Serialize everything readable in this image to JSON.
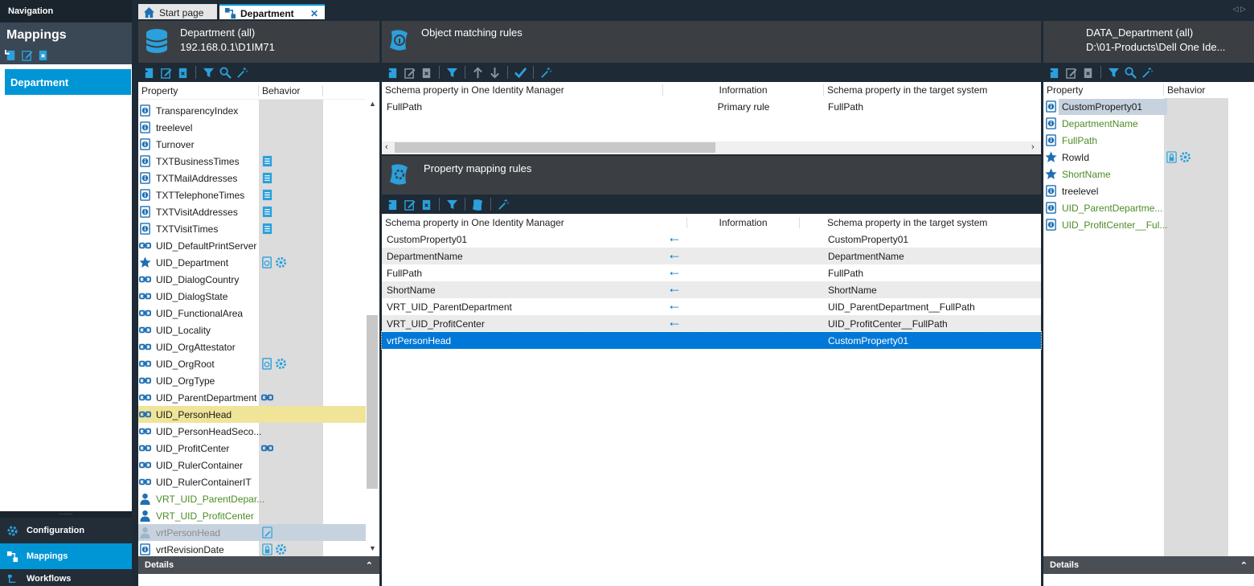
{
  "navigation": {
    "title": "Navigation",
    "section_title": "Mappings",
    "selected_item": "Department",
    "bottom": [
      {
        "label": "Configuration",
        "icon": "gear-icon"
      },
      {
        "label": "Mappings",
        "icon": "mappings-icon"
      },
      {
        "label": "Workflows",
        "icon": "workflow-icon"
      }
    ]
  },
  "tabs": [
    {
      "label": "Start page",
      "icon": "home-icon"
    },
    {
      "label": "Department",
      "icon": "mapping-icon",
      "active": true
    }
  ],
  "left_pane": {
    "title": "Department (all)",
    "subtitle": "192.168.0.1\\D1IM71",
    "col_property": "Property",
    "col_behavior": "Behavior",
    "rows": [
      {
        "label": "TransparencyIndex",
        "icon": "info",
        "style": "normal"
      },
      {
        "label": "treelevel",
        "icon": "info",
        "style": "normal"
      },
      {
        "label": "Turnover",
        "icon": "info",
        "style": "normal"
      },
      {
        "label": "TXTBusinessTimes",
        "icon": "info",
        "style": "normal",
        "behavior": [
          "list"
        ]
      },
      {
        "label": "TXTMailAddresses",
        "icon": "info",
        "style": "normal",
        "behavior": [
          "list"
        ]
      },
      {
        "label": "TXTTelephoneTimes",
        "icon": "info",
        "style": "normal",
        "behavior": [
          "list"
        ]
      },
      {
        "label": "TXTVisitAddresses",
        "icon": "info",
        "style": "normal",
        "behavior": [
          "list"
        ]
      },
      {
        "label": "TXTVisitTimes",
        "icon": "info",
        "style": "normal",
        "behavior": [
          "list"
        ]
      },
      {
        "label": "UID_DefaultPrintServer",
        "icon": "link",
        "style": "normal"
      },
      {
        "label": "UID_Department",
        "icon": "star",
        "style": "normal",
        "behavior": [
          "doc",
          "gear"
        ]
      },
      {
        "label": "UID_DialogCountry",
        "icon": "link",
        "style": "normal"
      },
      {
        "label": "UID_DialogState",
        "icon": "link",
        "style": "normal"
      },
      {
        "label": "UID_FunctionalArea",
        "icon": "link",
        "style": "normal"
      },
      {
        "label": "UID_Locality",
        "icon": "link",
        "style": "normal"
      },
      {
        "label": "UID_OrgAttestator",
        "icon": "link",
        "style": "normal"
      },
      {
        "label": "UID_OrgRoot",
        "icon": "link",
        "style": "normal",
        "behavior": [
          "doc",
          "gear"
        ]
      },
      {
        "label": "UID_OrgType",
        "icon": "link",
        "style": "normal"
      },
      {
        "label": "UID_ParentDepartment",
        "icon": "link",
        "style": "normal",
        "behavior": [
          "link"
        ]
      },
      {
        "label": "UID_PersonHead",
        "icon": "link",
        "style": "highlight"
      },
      {
        "label": "UID_PersonHeadSeco...",
        "icon": "link",
        "style": "normal"
      },
      {
        "label": "UID_ProfitCenter",
        "icon": "link",
        "style": "normal",
        "behavior": [
          "link"
        ]
      },
      {
        "label": "UID_RulerContainer",
        "icon": "link",
        "style": "normal"
      },
      {
        "label": "UID_RulerContainerIT",
        "icon": "link",
        "style": "normal"
      },
      {
        "label": "VRT_UID_ParentDepar...",
        "icon": "person",
        "style": "green"
      },
      {
        "label": "VRT_UID_ProfitCenter",
        "icon": "person",
        "style": "green"
      },
      {
        "label": "vrtPersonHead",
        "icon": "person-grey",
        "style": "selected",
        "behavior": [
          "edit"
        ]
      },
      {
        "label": "vrtRevisionDate",
        "icon": "info",
        "style": "normal",
        "behavior": [
          "lock",
          "gear"
        ]
      }
    ],
    "details_label": "Details"
  },
  "object_matching": {
    "title": "Object matching rules",
    "col_left": "Schema property in One Identity Manager",
    "col_info": "Information",
    "col_right": "Schema property in the target system",
    "rows": [
      {
        "left": "FullPath",
        "info": "Primary rule",
        "right": "FullPath"
      }
    ]
  },
  "property_mapping": {
    "title": "Property mapping rules",
    "col_left": "Schema property in One Identity Manager",
    "col_info": "Information",
    "col_right": "Schema property in the target system",
    "rows": [
      {
        "left": "CustomProperty01",
        "arrow": true,
        "right": "CustomProperty01",
        "style": "normal"
      },
      {
        "left": "DepartmentName",
        "arrow": true,
        "right": "DepartmentName",
        "style": "alt"
      },
      {
        "left": "FullPath",
        "arrow": true,
        "right": "FullPath",
        "style": "normal"
      },
      {
        "left": "ShortName",
        "arrow": true,
        "right": "ShortName",
        "style": "alt"
      },
      {
        "left": "VRT_UID_ParentDepartment",
        "arrow": true,
        "right": "UID_ParentDepartment__FullPath",
        "style": "normal"
      },
      {
        "left": "VRT_UID_ProfitCenter",
        "arrow": true,
        "right": "UID_ProfitCenter__FullPath",
        "style": "alt"
      },
      {
        "left": "vrtPersonHead",
        "arrow": false,
        "right": "CustomProperty01",
        "style": "selected"
      }
    ]
  },
  "right_pane": {
    "title": "DATA_Department (all)",
    "subtitle": "D:\\01-Products\\Dell One Ide...",
    "col_property": "Property",
    "col_behavior": "Behavior",
    "rows": [
      {
        "label": "CustomProperty01",
        "icon": "info",
        "style": "selected"
      },
      {
        "label": "DepartmentName",
        "icon": "info",
        "style": "green"
      },
      {
        "label": "FullPath",
        "icon": "info",
        "style": "green"
      },
      {
        "label": "RowId",
        "icon": "star",
        "style": "normal",
        "behavior": [
          "lock",
          "gear"
        ]
      },
      {
        "label": "ShortName",
        "icon": "star",
        "style": "green"
      },
      {
        "label": "treelevel",
        "icon": "info-dark",
        "style": "normal"
      },
      {
        "label": "UID_ParentDepartme...",
        "icon": "info",
        "style": "green"
      },
      {
        "label": "UID_ProfitCenter__Ful...",
        "icon": "info",
        "style": "green"
      }
    ],
    "details_label": "Details"
  },
  "colors": {
    "accent": "#0096d6",
    "dark_bg": "#1e2a35",
    "header_bg": "#3b3f44",
    "highlight_yellow": "#f0e498",
    "selected_grey": "#c6d3df",
    "selected_blue": "#0078d7",
    "green_text": "#4b8c25"
  }
}
